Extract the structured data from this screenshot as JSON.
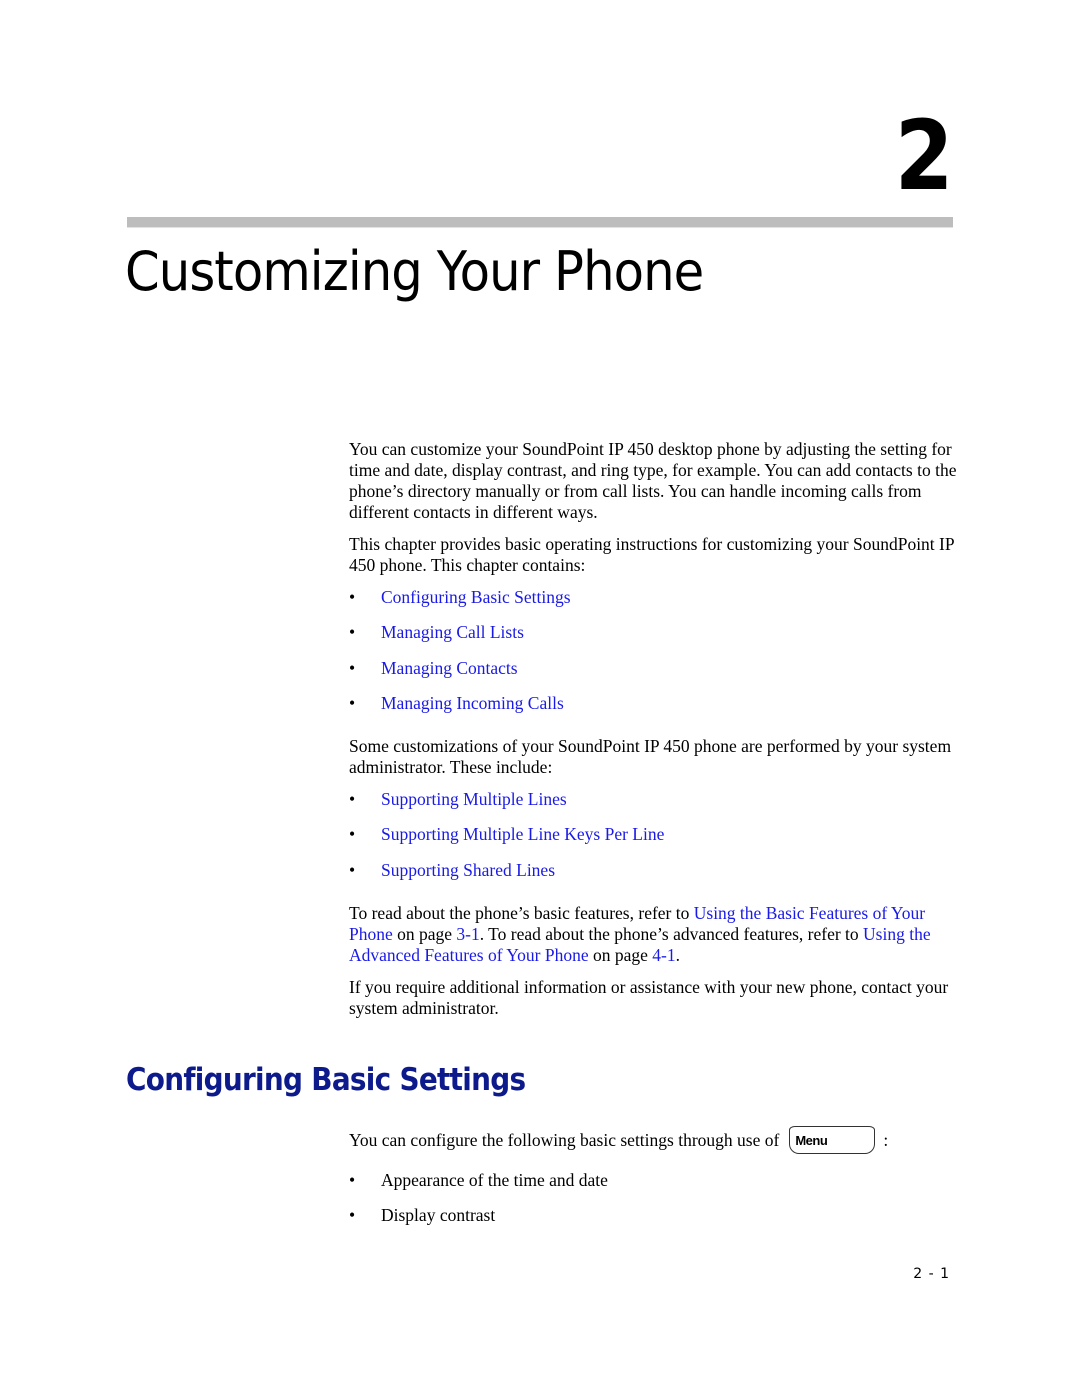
{
  "chapter": {
    "number": "2",
    "title": "Customizing Your Phone"
  },
  "intro": {
    "paragraph1": "You can customize your SoundPoint IP 450 desktop phone by adjusting the setting for time and date, display contrast, and ring type, for example. You can add contacts to the phone’s directory manually or from call lists. You can handle incoming calls from different contacts in different ways.",
    "paragraph2": "This chapter provides basic operating instructions for customizing your SoundPoint IP 450 phone. This chapter contains:",
    "chapter_contents": [
      {
        "label": "Configuring Basic Settings"
      },
      {
        "label": "Managing Call Lists"
      },
      {
        "label": "Managing Contacts"
      },
      {
        "label": "Managing Incoming Calls"
      }
    ],
    "paragraph3": "Some customizations of your SoundPoint IP 450 phone are performed by your system administrator. These include:",
    "admin_items": [
      {
        "label": "Supporting Multiple Lines"
      },
      {
        "label": "Supporting Multiple Line Keys Per Line"
      },
      {
        "label": "Supporting Shared Lines"
      }
    ],
    "refer": {
      "text1": "To read about the phone’s basic features, refer to ",
      "link1": "Using the Basic Features of Your Phone",
      "text2": " on page ",
      "page1": "3-1",
      "text3": ". To read about the phone’s advanced features, refer to ",
      "link2": "Using the Advanced Features of Your Phone",
      "text4": " on page ",
      "page2": "4-1",
      "text5": "."
    },
    "paragraph5": "If you require additional information or assistance with your new phone, contact your system administrator."
  },
  "section": {
    "heading": "Configuring Basic Settings",
    "intro_text": "You can configure the following basic settings through use of",
    "menu_key_label": "Menu",
    "intro_suffix": ":",
    "items": [
      {
        "label": "Appearance of the time and date"
      },
      {
        "label": "Display contrast"
      }
    ]
  },
  "bullet_glyph": "•",
  "colors": {
    "link": "#1a1ae6",
    "heading": "#0c1a8c",
    "rule": "#bdbdbd"
  },
  "footer": {
    "page_number": "2 - 1"
  }
}
